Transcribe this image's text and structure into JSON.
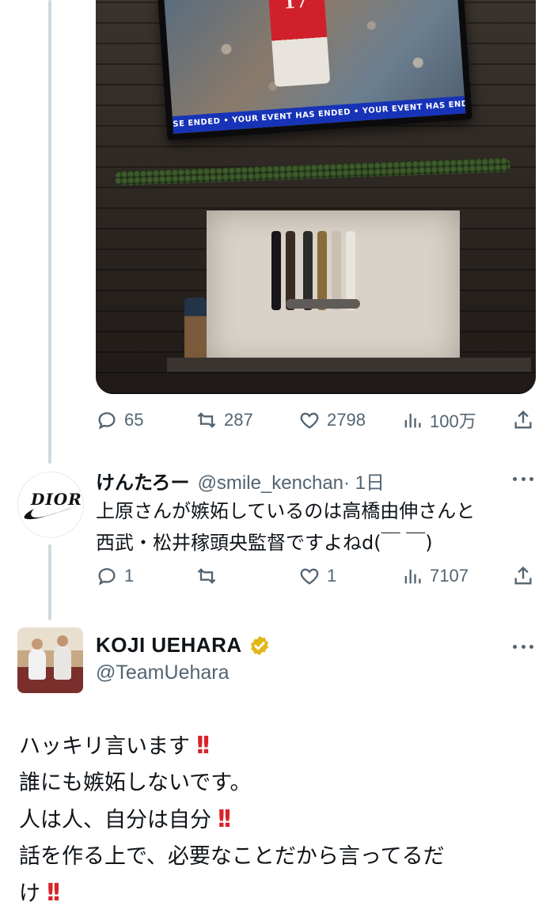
{
  "colors": {
    "accent": "#1d9bf0",
    "muted": "#536471",
    "text": "#0f1419",
    "thread_line": "#cfd9de",
    "emphasis": "#d8232a",
    "verified_gold": "#e2b719"
  },
  "media": {
    "ticker_text": "SE ENDED  •  YOUR EVENT HAS ENDED  •  YOUR EVENT HAS ENDED  •  YOUR EVENT HAS ENDED  •  YOUR",
    "jersey_number": "17"
  },
  "first_actions": {
    "replies": "65",
    "reposts": "287",
    "likes": "2798",
    "views": "100万"
  },
  "reply_tweet": {
    "avatar_brand": "DIOR",
    "name": "けんたろー",
    "handle": "@smile_kenchan",
    "time": "· 1日",
    "text_lines": [
      "上原さんが嫉妬しているのは高橋由伸さんと",
      "西武・松井稼頭央監督ですよねd(￣ ￣)"
    ],
    "actions": {
      "replies": "1",
      "reposts": "",
      "likes": "1",
      "views": "7107"
    }
  },
  "main_tweet": {
    "name": "KOJI  UEHARA",
    "handle": "@TeamUehara",
    "text_lines": [
      {
        "text": "ハッキリ言います",
        "bang": "!!"
      },
      {
        "text": "誰にも嫉妬しないです。",
        "bang": ""
      },
      {
        "text": "人は人、自分は自分",
        "bang": "!!"
      },
      {
        "text": "話を作る上で、必要なことだから言ってるだ",
        "bang": ""
      },
      {
        "text": "け",
        "bang": "!!"
      }
    ]
  }
}
